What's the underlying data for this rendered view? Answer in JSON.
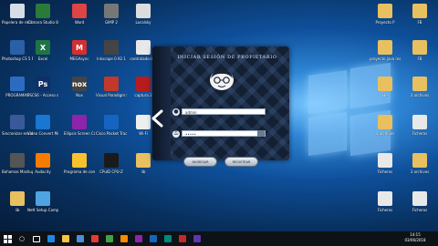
{
  "desktop": {
    "left_icons": [
      {
        "label": "Papelera de reciclaje",
        "color": "#d6dde6",
        "glyph": ""
      },
      {
        "label": "Cámara Studio 8",
        "color": "#2a7a3a",
        "glyph": ""
      },
      {
        "label": "Word",
        "color": "#d44",
        "glyph": ""
      },
      {
        "label": "GIMP 2",
        "color": "#777",
        "glyph": ""
      },
      {
        "label": "Localsky",
        "color": "#ddd",
        "glyph": ""
      },
      {
        "label": "Photoshop CS 5 Professional",
        "color": "#2b5fa6",
        "glyph": ""
      },
      {
        "label": "Excel",
        "color": "#217346",
        "glyph": "X"
      },
      {
        "label": "MEGAsync",
        "color": "#d32f2f",
        "glyph": "M"
      },
      {
        "label": "Inkscape 0.92.1",
        "color": "#444",
        "glyph": ""
      },
      {
        "label": "controlador.txt",
        "color": "#e8e8e8",
        "glyph": ""
      },
      {
        "label": "PROGRAMAS",
        "color": "#2d6bc1",
        "glyph": ""
      },
      {
        "label": "PSCS6 - Acceso directo",
        "color": "#0f2f66",
        "glyph": "Ps"
      },
      {
        "label": "Nox",
        "color": "#444",
        "glyph": "nox"
      },
      {
        "label": "Visual Paradigm for UML 10.0",
        "color": "#c0392b",
        "glyph": ""
      },
      {
        "label": "captura 2",
        "color": "#b71c1c",
        "glyph": ""
      },
      {
        "label": "Sincronizar ensamblado",
        "color": "#3b5998",
        "glyph": ""
      },
      {
        "label": "Video Convert Master",
        "color": "#1976d2",
        "glyph": ""
      },
      {
        "label": "Ellipsis Screen Capture 8",
        "color": "#8e24aa",
        "glyph": ""
      },
      {
        "label": "Cisco Packet Tracer",
        "color": "#1565c0",
        "glyph": ""
      },
      {
        "label": "Wi-Fi",
        "color": "#eee",
        "glyph": ""
      },
      {
        "label": "Bahamas Mashups 3",
        "color": "#555",
        "glyph": ""
      },
      {
        "label": "Audacity",
        "color": "#f57c00",
        "glyph": ""
      },
      {
        "label": "Programa de computación",
        "color": "#fbc02d",
        "glyph": ""
      },
      {
        "label": "CPuID CPU-Z",
        "color": "#1a1a1a",
        "glyph": ""
      },
      {
        "label": "lib",
        "color": "#e8c060",
        "glyph": ""
      },
      {
        "label": "lib",
        "color": "#e8c060",
        "glyph": ""
      },
      {
        "label": "Nett Setup Computer",
        "color": "#4fa3e0",
        "glyph": ""
      }
    ],
    "right_icons": [
      {
        "label": "Proyecto P",
        "color": "#e8c060"
      },
      {
        "label": "FB",
        "color": "#e8c060"
      },
      {
        "label": "proyecto java instalador",
        "color": "#e8c060"
      },
      {
        "label": "FB",
        "color": "#e8c060"
      },
      {
        "label": "HP",
        "color": "#e8c060"
      },
      {
        "label": "3 archivos",
        "color": "#e8c060"
      },
      {
        "label": "3 archivos",
        "color": "#e8c060"
      },
      {
        "label": "Ficheros",
        "color": "#e8e8e8"
      },
      {
        "label": "Ficheros",
        "color": "#e8e8e8"
      },
      {
        "label": "3 archivos",
        "color": "#e8c060"
      },
      {
        "label": "Ficheros",
        "color": "#e8e8e8"
      },
      {
        "label": "Ficheros",
        "color": "#e8e8e8"
      }
    ]
  },
  "login": {
    "title": "INICIAR SESIÓN DE PROPIETARIO",
    "user_value": "admin",
    "password_value": "•••••",
    "btn_ingresar": "INGRESAR",
    "btn_registrar": "REGISTRAR"
  },
  "taskbar": {
    "clock_time": "14:15",
    "clock_date": "03/06/2018"
  }
}
